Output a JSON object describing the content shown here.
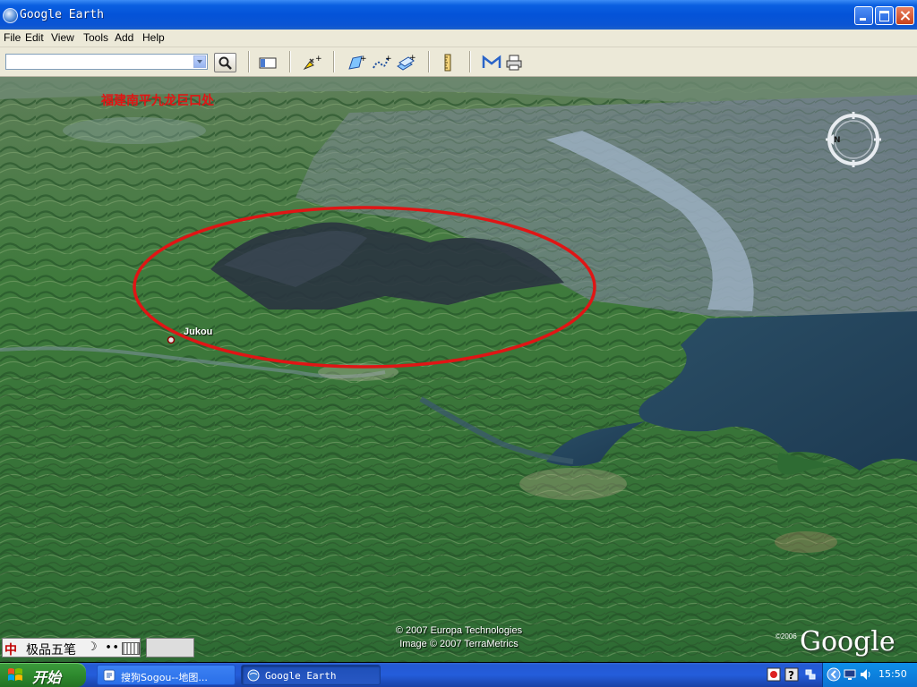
{
  "window": {
    "title": "Google Earth"
  },
  "menu": [
    "File",
    "Edit",
    "View",
    "Tools",
    "Add",
    "Help"
  ],
  "search": {
    "value": "",
    "placeholder": ""
  },
  "toolbar": {
    "tools": [
      "sidebar-toggle-icon",
      "add-placemark-icon",
      "add-polygon-icon",
      "add-path-icon",
      "add-image-overlay-icon",
      "ruler-icon",
      "email-icon",
      "print-icon"
    ]
  },
  "map": {
    "overlay_title": "福建南平九龙巨口处",
    "place_label": "Jukou",
    "copyright_1": "© 2007 Europa Technologies",
    "copyright_2": "Image © 2007 TerraMetrics",
    "logo_year": "©2006",
    "logo": "Google",
    "annotation_color": "#e01515"
  },
  "ime": {
    "icon": "中",
    "name": "极品五笔"
  },
  "taskbar": {
    "start_label": "开始",
    "tasks": [
      "搜狗Sogou--地图...",
      "Google Earth"
    ],
    "clock": "15:50"
  }
}
